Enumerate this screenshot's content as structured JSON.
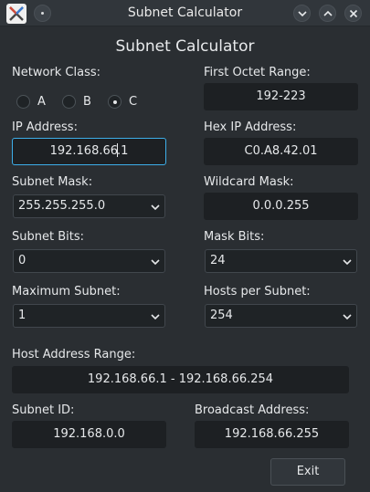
{
  "window": {
    "title": "Subnet Calculator"
  },
  "heading": "Subnet Calculator",
  "network_class": {
    "label": "Network Class:",
    "options": [
      {
        "label": "A",
        "checked": false
      },
      {
        "label": "B",
        "checked": false
      },
      {
        "label": "C",
        "checked": true
      }
    ]
  },
  "first_octet_range": {
    "label": "First Octet Range:",
    "value": "192-223"
  },
  "ip_address": {
    "label": "IP Address:",
    "value_before_caret": "192.168.66",
    "value_after_caret": ".1"
  },
  "hex_ip_address": {
    "label": "Hex IP Address:",
    "value": "C0.A8.42.01"
  },
  "subnet_mask": {
    "label": "Subnet Mask:",
    "selected": "255.255.255.0"
  },
  "wildcard_mask": {
    "label": "Wildcard Mask:",
    "value": "0.0.0.255"
  },
  "subnet_bits": {
    "label": "Subnet Bits:",
    "selected": "0"
  },
  "mask_bits": {
    "label": "Mask Bits:",
    "selected": "24"
  },
  "maximum_subnet": {
    "label": "Maximum Subnet:",
    "selected": "1"
  },
  "hosts_per_subnet": {
    "label": "Hosts per Subnet:",
    "selected": "254"
  },
  "host_address_range": {
    "label": "Host Address Range:",
    "value": "192.168.66.1 - 192.168.66.254"
  },
  "subnet_id": {
    "label": "Subnet ID:",
    "value": "192.168.0.0"
  },
  "broadcast_address": {
    "label": "Broadcast Address:",
    "value": "192.168.66.255"
  },
  "exit_button": {
    "label": "Exit"
  },
  "icons": {
    "app": "network-x-icon",
    "menu": "window-menu-icon",
    "minimize": "chevron-down-icon",
    "maximize": "chevron-up-icon",
    "close": "close-icon",
    "dropdown": "chevron-down-icon"
  }
}
